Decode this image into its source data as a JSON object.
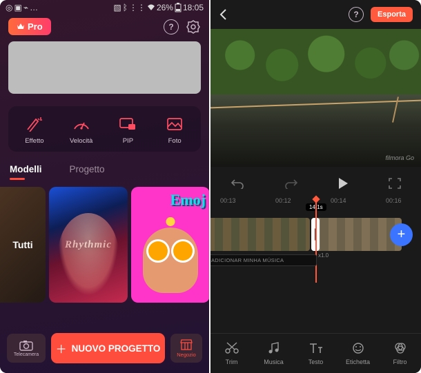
{
  "status": {
    "time": "18:05",
    "battery": "26%"
  },
  "pro_label": "Pro",
  "tools": {
    "effect": "Effetto",
    "speed": "Velocità",
    "pip": "PIP",
    "photo": "Foto"
  },
  "tabs": {
    "templates": "Modelli",
    "project": "Progetto"
  },
  "templates": {
    "all": "Tutti",
    "rhythmic": "Rhythmic",
    "emoji": "Emoj"
  },
  "bottom": {
    "camera": "Telecamera",
    "new_project": "NUOVO PROGETTO",
    "shop": "Negozio"
  },
  "editor": {
    "export": "Esporta",
    "watermark": "filmora Go",
    "times": {
      "t1": "00:13",
      "t2": "00:12",
      "t3": "00:14",
      "t4": "00:16"
    },
    "speed": "x1.0",
    "speed_marker": "14.1s",
    "music": "ADICIONAR MINHA MÚSICA",
    "tools": {
      "trim": "Trim",
      "music": "Musica",
      "text": "Testo",
      "label": "Etichetta",
      "filter": "Filtro"
    }
  }
}
